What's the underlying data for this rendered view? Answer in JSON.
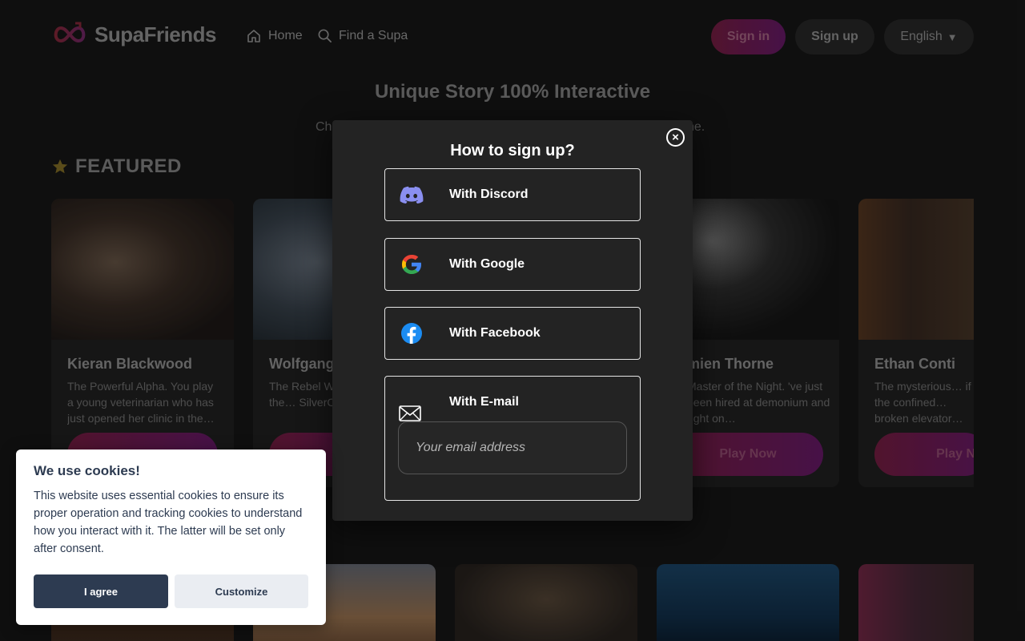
{
  "header": {
    "logo_text": "SupaFriends",
    "nav": {
      "home": "Home",
      "find": "Find a Supa"
    },
    "signin_label": "Sign in",
    "signup_label": "Sign up",
    "language_label": "English",
    "language_caret": "▼"
  },
  "hero": {
    "title": "Unique Story 100% Interactive",
    "subtitle_start": "Ch",
    "subtitle_end": "ne."
  },
  "featured": {
    "label": "FEATURED"
  },
  "cards": [
    {
      "name": "Kieran Blackwood",
      "desc": "The Powerful Alpha. You play a young veterinarian who has just opened her clinic in the…",
      "play": ""
    },
    {
      "name": "Wolfgang",
      "desc": "The Rebel W… arrived in the… SilverCliff fo…",
      "play": "a"
    },
    {
      "name": "mien Thorne",
      "desc": "Master of the Night. 've just been hired at demonium and right on…",
      "play": "Play Now"
    },
    {
      "name": "Ethan Conti",
      "desc": "The mysterious… if the confined… broken elevator…",
      "play": "Play N"
    }
  ],
  "modal": {
    "title": "How to sign up?",
    "close": "×",
    "options": {
      "discord": "With Discord",
      "google": "With Google",
      "facebook": "With Facebook",
      "email": "With E-mail"
    },
    "email_placeholder": "Your email address"
  },
  "cookie": {
    "title": "We use cookies!",
    "text": "This website uses essential cookies to ensure its proper operation and tracking cookies to understand how you interact with it. The latter will be set only after consent.",
    "agree": "I agree",
    "customize": "Customize"
  },
  "colors": {
    "background": "#181818",
    "accent_gradient_start": "#7d1f46",
    "accent_gradient_end": "#6d1b6e",
    "modal_bg": "#232323",
    "cookie_primary": "#2d3b51"
  }
}
